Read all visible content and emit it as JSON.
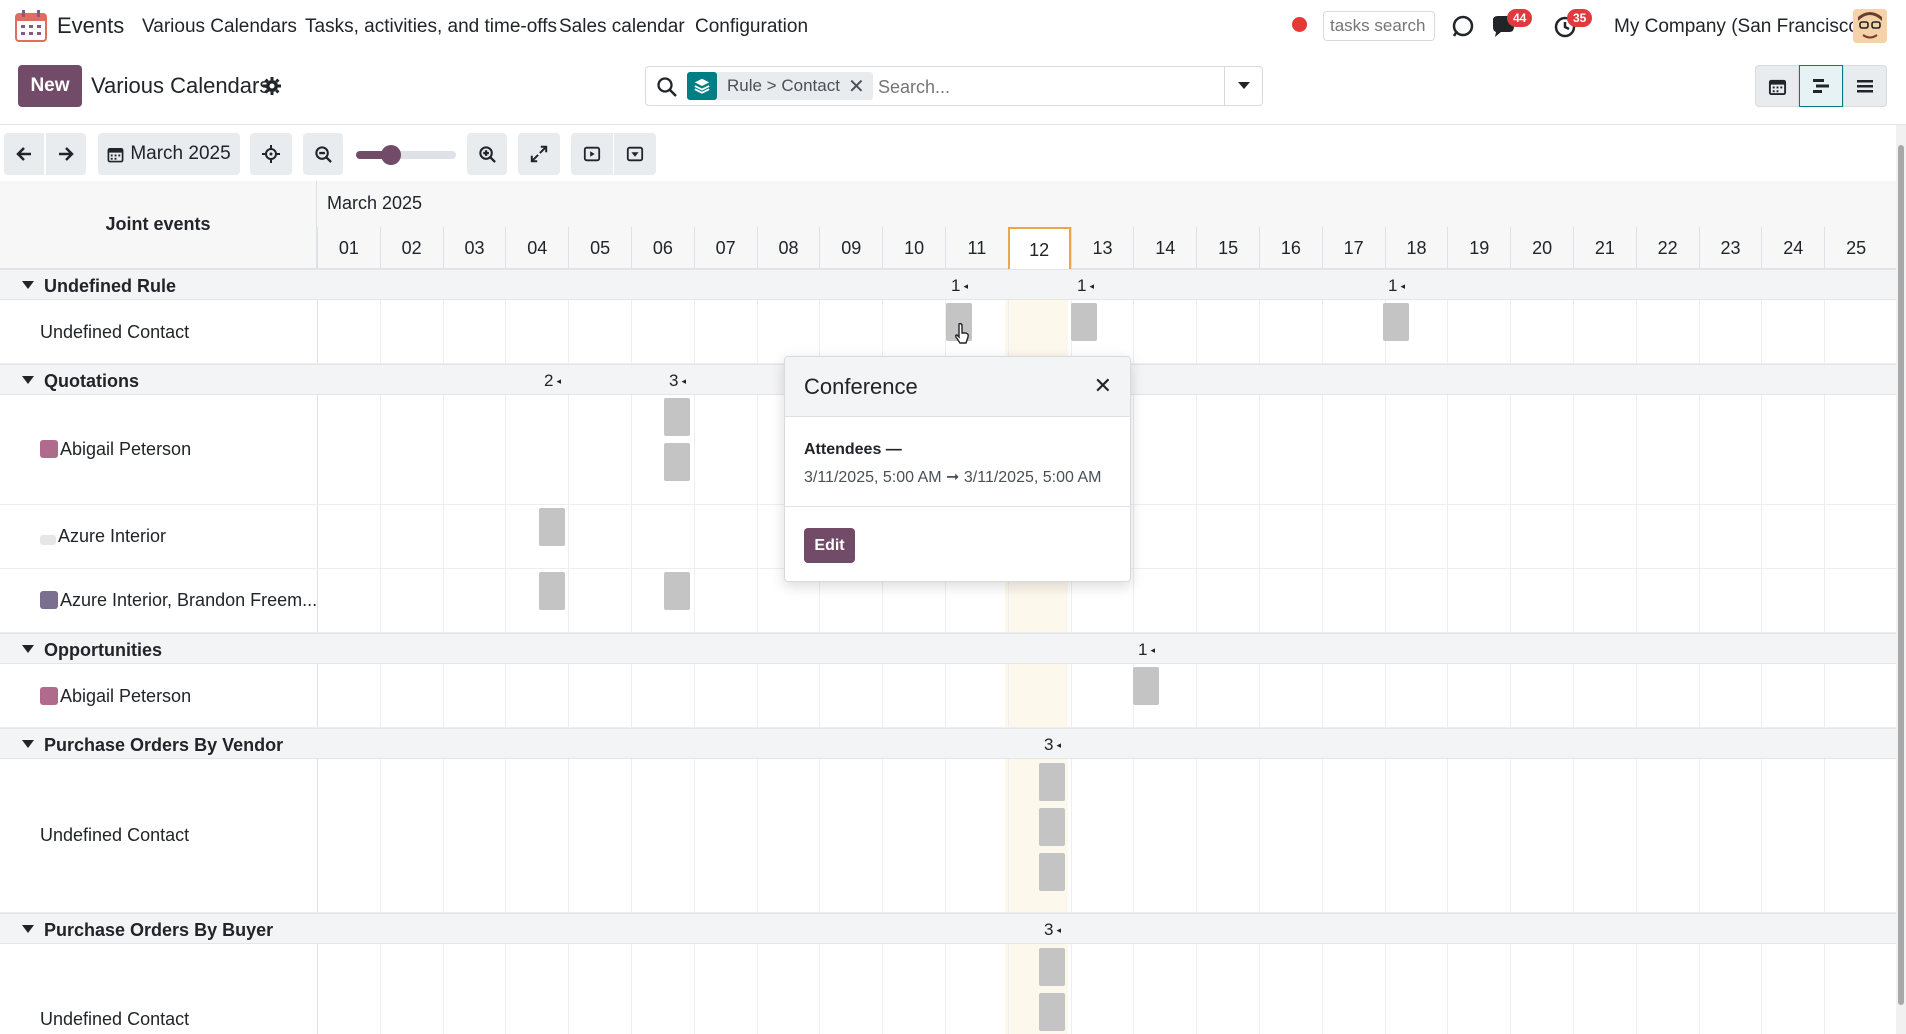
{
  "navbar": {
    "app_name": "Events",
    "menu": [
      "Various Calendars",
      "Tasks, activities, and time-offs",
      "Sales calendar",
      "Configuration"
    ],
    "tasks_search_placeholder": "tasks search",
    "messages_badge": "44",
    "activities_badge": "35",
    "company": "My Company (San Francisco)"
  },
  "control": {
    "new_label": "New",
    "title": "Various Calendars",
    "facet_label": "Rule > Contact",
    "facet_close": "✕",
    "search_placeholder": "Search..."
  },
  "toolbar": {
    "date_label": "March 2025",
    "zoom_level": 0.35
  },
  "gantt": {
    "header_left": "Joint events",
    "month": "March 2025",
    "days": [
      "01",
      "02",
      "03",
      "04",
      "05",
      "06",
      "07",
      "08",
      "09",
      "10",
      "11",
      "12",
      "13",
      "14",
      "15",
      "16",
      "17",
      "18",
      "19",
      "20",
      "21",
      "22",
      "23",
      "24",
      "25"
    ],
    "today": "12",
    "groups": [
      {
        "name": "Undefined Rule",
        "rows": [
          "Undefined Contact"
        ]
      },
      {
        "name": "Quotations",
        "rows": [
          "Abigail Peterson",
          "Azure Interior",
          "Azure Interior, Brandon Freem..."
        ]
      },
      {
        "name": "Opportunities",
        "rows": [
          "Abigail Peterson"
        ]
      },
      {
        "name": "Purchase Orders By Vendor",
        "rows": [
          "Undefined Contact"
        ]
      },
      {
        "name": "Purchase Orders By Buyer",
        "rows": [
          "Undefined Contact"
        ]
      }
    ],
    "counts": {
      "undefined_rule": [
        "1",
        "1",
        "1"
      ],
      "quotations": [
        "2",
        "3"
      ],
      "opportunities": [
        "1"
      ],
      "po_vendor": [
        "3"
      ],
      "po_buyer": [
        "3"
      ]
    }
  },
  "popover": {
    "title": "Conference",
    "close": "✕",
    "attendees": "Attendees —",
    "dates": "3/11/2025, 5:00 AM ➞ 3/11/2025, 5:00 AM",
    "edit_label": "Edit"
  },
  "colors": {
    "brand": "#714b67",
    "teal": "#017e84",
    "pill": "#c4c4c4",
    "today_bg": "#fdf8ec"
  }
}
